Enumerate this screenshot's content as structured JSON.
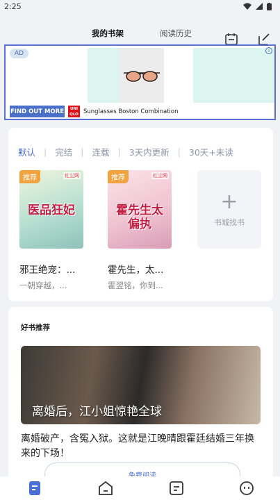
{
  "status_bar": {
    "time": "2:25",
    "icons": [
      "wifi-icon",
      "signal-icon",
      "battery-icon"
    ]
  },
  "header": {
    "tabs": [
      {
        "label": "我的书架",
        "active": true
      },
      {
        "label": "阅读历史",
        "active": false
      }
    ],
    "icons": [
      "calendar-icon",
      "edit-icon"
    ]
  },
  "ad": {
    "badge": "AD",
    "cta_label": "FIND OUT MORE",
    "logo_text": [
      "UNI",
      "QLO"
    ],
    "description": "Sunglasses Boston Combination"
  },
  "shelf": {
    "filters": [
      {
        "label": "默认",
        "active": true
      },
      {
        "label": "完结",
        "active": false
      },
      {
        "label": "连载",
        "active": false
      },
      {
        "label": "3天内更新",
        "active": false
      },
      {
        "label": "30天+未读",
        "active": false
      }
    ],
    "books": [
      {
        "badge": "推荐",
        "site": "红尘网",
        "cover_title": "医品狂妃",
        "title": "邪王绝宠：...",
        "subtitle": "一朝穿越，...",
        "colors": [
          "#e8f3d8",
          "#9fd0c6"
        ]
      },
      {
        "badge": "推荐",
        "site": "红尘网",
        "cover_title": "霍先生太偏执",
        "title": "霍先生，太...",
        "subtitle": "霍翌铭，你到...",
        "colors": [
          "#f7d3dd",
          "#e5b6c6"
        ]
      }
    ],
    "find_store": {
      "icon": "plus-icon",
      "label": "书城找书"
    }
  },
  "recommend": {
    "heading": "好书推荐",
    "banner_title": "离婚后，江小姐惊艳全球",
    "description": "离婚破产，含冤入狱。这就是江晚晴跟霍廷结婚三年换来的下场！",
    "button_label": "免费阅读"
  },
  "bottom_nav": {
    "items": [
      "bookshelf-icon",
      "store-icon",
      "category-icon",
      "profile-icon"
    ],
    "active_color": "#4a6fd6"
  },
  "accent_color": "#4a6fd6"
}
